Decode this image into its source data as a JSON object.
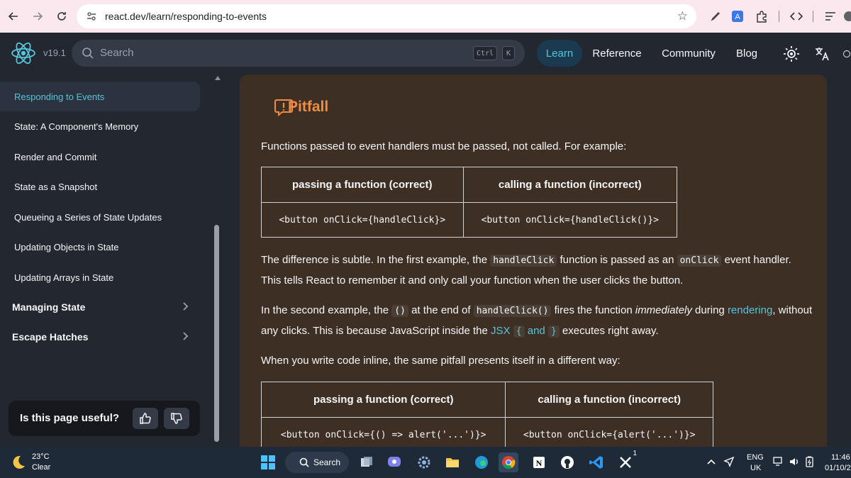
{
  "browser": {
    "url": "react.dev/learn/responding-to-events",
    "icons": [
      "back-arrow-icon",
      "forward-arrow-icon",
      "reload-icon",
      "site-settings-icon",
      "bookmark-star-icon",
      "pen-icon",
      "translate-extension-icon",
      "extensions-puzzle-icon",
      "devtools-icon",
      "reading-list-icon",
      "profile-icon"
    ]
  },
  "header": {
    "version": "v19.1",
    "search_placeholder": "Search",
    "kbd_ctrl": "Ctrl",
    "kbd_k": "K",
    "nav": {
      "learn": "Learn",
      "reference": "Reference",
      "community": "Community",
      "blog": "Blog"
    },
    "accent": "#58c4dc"
  },
  "sidebar": {
    "items": [
      {
        "label": "Responding to Events",
        "active": true
      },
      {
        "label": "State: A Component's Memory"
      },
      {
        "label": "Render and Commit"
      },
      {
        "label": "State as a Snapshot"
      },
      {
        "label": "Queueing a Series of State Updates"
      },
      {
        "label": "Updating Objects in State"
      },
      {
        "label": "Updating Arrays in State"
      }
    ],
    "sections": [
      {
        "label": "Managing State"
      },
      {
        "label": "Escape Hatches"
      }
    ],
    "feedback_question": "Is this page useful?"
  },
  "main": {
    "pitfall_title": "Pitfall",
    "pitfall_color": "#f08c44",
    "p1": "Functions passed to event handlers must be passed, not called. For example:",
    "table1": {
      "headers": [
        "passing a function (correct)",
        "calling a function (incorrect)"
      ],
      "row": [
        "<button onClick={handleClick}>",
        "<button onClick={handleClick()}>"
      ]
    },
    "p2": {
      "a": "The difference is subtle. In the first example, the ",
      "code1": "handleClick",
      "b": " function is passed as an ",
      "code2": "onClick",
      "c": " event handler. This tells React to remember it and only call your function when the user clicks the button."
    },
    "p3": {
      "a": "In the second example, the ",
      "code1": "()",
      "b": " at the end of ",
      "code2": "handleClick()",
      "c": " fires the function ",
      "em": "immediately",
      "d": " during ",
      "link1": "rendering",
      "e": ", without any clicks. This is because JavaScript inside the ",
      "link2": "JSX",
      "code3": "{",
      "f": " and ",
      "code4": "}",
      "g": " executes right away."
    },
    "p4": "When you write code inline, the same pitfall presents itself in a different way:",
    "table2": {
      "headers": [
        "passing a function (correct)",
        "calling a function (incorrect)"
      ],
      "row": [
        "<button onClick={() => alert('...')}>",
        "<button onClick={alert('...')}>"
      ]
    }
  },
  "taskbar": {
    "temperature": "23°C",
    "condition": "Clear",
    "search_label": "Search",
    "x_badge": "1",
    "lang_top": "ENG",
    "lang_bottom": "UK",
    "time": "11:46",
    "date": "01/10/2"
  }
}
